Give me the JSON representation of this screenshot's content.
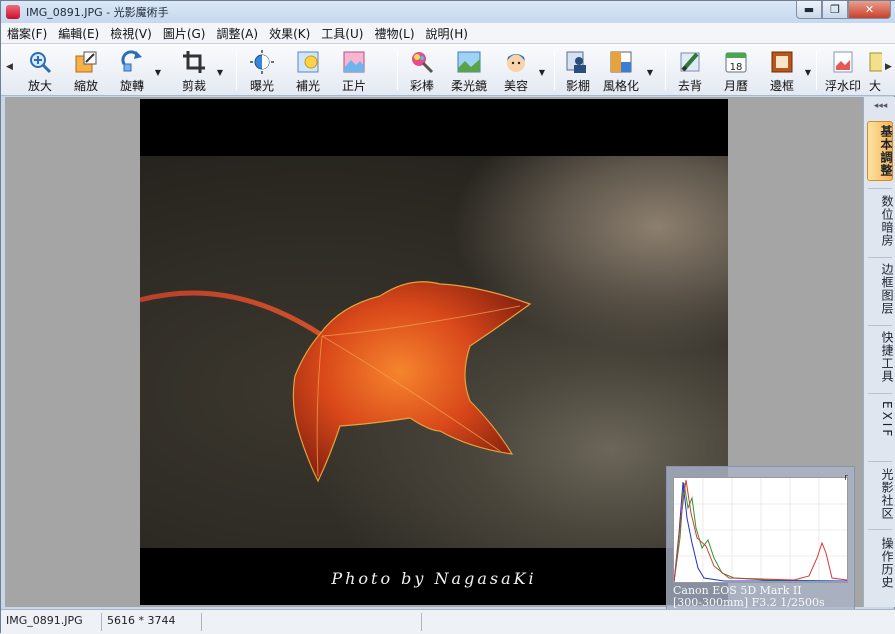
{
  "window": {
    "title": "IMG_0891.JPG - 光影魔術手",
    "min": "▬",
    "max": "❐",
    "close": "✕"
  },
  "menu": [
    "檔案(F)",
    "編輯(E)",
    "檢視(V)",
    "圖片(G)",
    "調整(A)",
    "效果(K)",
    "工具(U)",
    "禮物(L)",
    "說明(H)"
  ],
  "toolbar": {
    "tools": [
      {
        "label": "放大",
        "icon": "zoom-in-icon"
      },
      {
        "label": "縮放",
        "icon": "resize-icon"
      },
      {
        "label": "旋轉",
        "icon": "rotate-icon"
      },
      {
        "label": "剪裁",
        "icon": "crop-icon"
      },
      {
        "label": "曝光",
        "icon": "exposure-icon"
      },
      {
        "label": "補光",
        "icon": "fill-light-icon"
      },
      {
        "label": "正片",
        "icon": "positive-film-icon"
      },
      {
        "label": "彩棒",
        "icon": "color-stick-icon"
      },
      {
        "label": "柔光鏡",
        "icon": "soft-light-icon"
      },
      {
        "label": "美容",
        "icon": "beauty-icon"
      },
      {
        "label": "影棚",
        "icon": "studio-icon"
      },
      {
        "label": "風格化",
        "icon": "stylize-icon"
      },
      {
        "label": "去背",
        "icon": "remove-bg-icon"
      },
      {
        "label": "月曆",
        "icon": "calendar-icon",
        "badge": "18"
      },
      {
        "label": "邊框",
        "icon": "frame-icon"
      },
      {
        "label": "浮水印",
        "icon": "watermark-icon"
      },
      {
        "label": "大",
        "icon": "more-icon"
      }
    ]
  },
  "photo": {
    "caption": "Photo by NagasaKi"
  },
  "histogram": {
    "corner": "r",
    "camera": "Canon EOS 5D Mark II",
    "settings": "[300-300mm] F3.2 1/2500s"
  },
  "right_panel": {
    "arrows": "◂◂◂",
    "tabs": [
      "基本調整",
      "数位暗房",
      "边框图层",
      "快捷工具",
      "EXIF",
      "光影社区",
      "操作历史"
    ]
  },
  "status": {
    "filename": "IMG_0891.JPG",
    "dimensions": "5616 * 3744"
  }
}
